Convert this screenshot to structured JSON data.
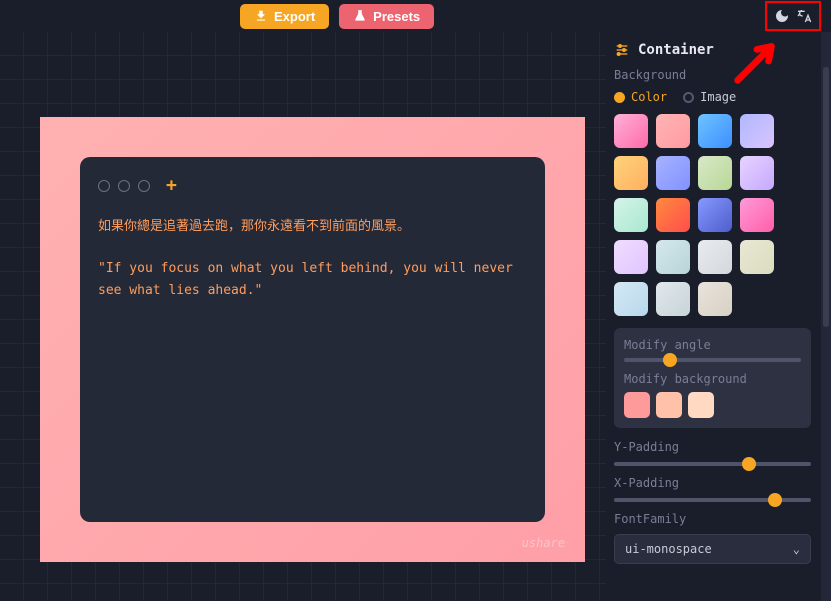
{
  "topbar": {
    "export": "Export",
    "presets": "Presets"
  },
  "editor": {
    "line1": "如果你總是追著過去跑，那你永遠看不到前面的風景。",
    "line2": "\"If you focus on what you left behind, you will never see what lies ahead.\"",
    "watermark": "ushare"
  },
  "sidebar": {
    "section": "Container",
    "background_label": "Background",
    "color_opt": "Color",
    "image_opt": "Image",
    "modify_angle": "Modify angle",
    "modify_bg": "Modify background",
    "ypad": "Y-Padding",
    "xpad": "X-Padding",
    "fontfamily": "FontFamily",
    "font_value": "ui-monospace"
  },
  "swatches": [
    "linear-gradient(135deg,#ffb0d8,#ff6ba8)",
    "linear-gradient(135deg,#ffb5b5,#ff9aa0)",
    "linear-gradient(135deg,#6ec3ff,#3d8fff)",
    "linear-gradient(135deg,#b0b8ff,#d9c4ff)",
    "linear-gradient(135deg,#ffd27a,#ffb060)",
    "linear-gradient(135deg,#a8b2ff,#8092ff)",
    "linear-gradient(135deg,#d8e8c8,#b8d895)",
    "linear-gradient(135deg,#e8d4ff,#c5a8ff)",
    "linear-gradient(135deg,#d4f4e8,#a8e8d0)",
    "linear-gradient(135deg,#ff8a3d,#ff4d4d)",
    "linear-gradient(135deg,#8899ff,#4d5dcc)",
    "linear-gradient(135deg,#ff9ad9,#ff5fa8)",
    "linear-gradient(135deg,#f0ddff,#e0c4ff)",
    "linear-gradient(135deg,#d4e8ec,#b8d4d8)",
    "linear-gradient(135deg,#e8ecf0,#d4d8dc)",
    "linear-gradient(135deg,#e8e8d4,#dcdcc0)",
    "linear-gradient(135deg,#d4e8f4,#b8d8ec)",
    "linear-gradient(135deg,#e0e8ec,#c8d4d8)",
    "linear-gradient(135deg,#e8e4dc,#d8d0c4)"
  ],
  "minisw": [
    "#ff9a9a",
    "#ffc2a8",
    "#ffd9c2"
  ]
}
